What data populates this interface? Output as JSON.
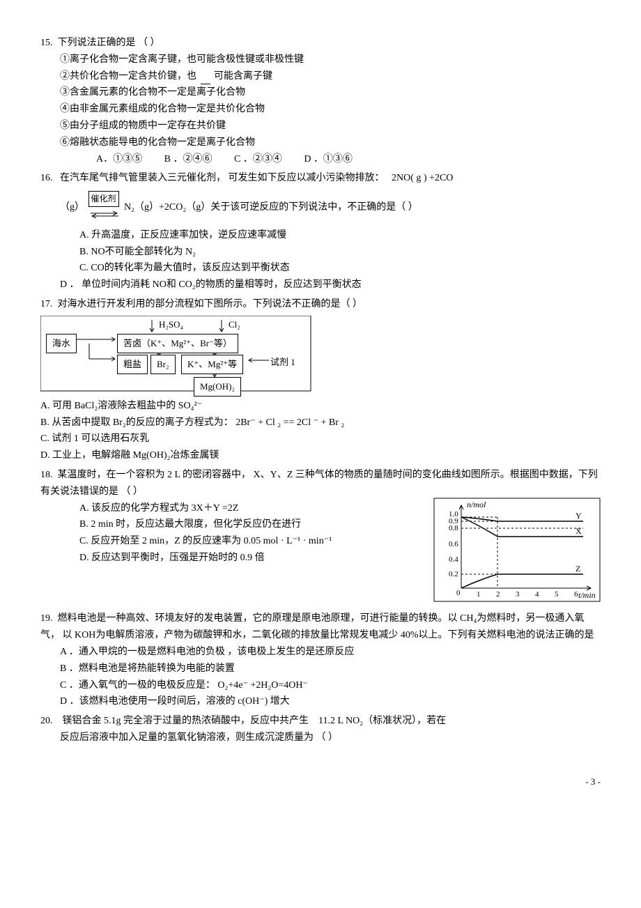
{
  "q15": {
    "stem": "下列说法正确的是        （            ）",
    "s1": "①离子化合物一定含离子键，也可能含极性键或非极性键",
    "s2_a": "②共价化合物一定含共价键，也",
    "s2_b": "可能含离子键",
    "s3": "③含金属元素的化合物不一定是离子化合物",
    "s4": "④由非金属元素组成的化合物一定是共价化合物",
    "s5": "⑤由分子组成的物质中一定存在共价键",
    "s6": "⑥熔融状态能导电的化合物一定是离子化合物",
    "optA": "A．①③⑤",
    "optB": "B ．②④⑥",
    "optC": "C ．②③④",
    "optD": "D ．①③⑥"
  },
  "q16": {
    "stem_a": "在汽车尾气排气管里装入三元催化剂，   可发生如下反应以减小污染物排放：",
    "stem_b": "2NO( g ) +2CO",
    "eq_left": "（g）",
    "eq_cat": "催化剂",
    "eq_right": "N₂（g）+2CO₂（g）关于该可逆反应的下列说法中，不正确的是（            ）",
    "A": "A.   升高温度，正反应速率加快，逆反应速率减慢",
    "B": "B.   NO不可能全部转化为    N₂",
    "C": "C.   CO的转化率为最大值时，该反应达到平衡状态",
    "D": "D ．  单位时间内消耗   NO和 CO₂的物质的量相等时，反应达到平衡状态"
  },
  "q17": {
    "stem": "对海水进行开发利用的部分流程如下图所示。下列说法不正确的是（               ）",
    "diag": {
      "seawater": "海水",
      "h2so4": "H₂SO₄",
      "cl2": "Cl₂",
      "bittern": "苦卤（K⁺、Mg²⁺、Br⁻等）",
      "coarsesalt": "粗盐",
      "br2": "Br₂",
      "kmg": "K⁺、Mg²⁺等",
      "reagent1": "试剂 1",
      "mgoh2": "Mg(OH)₂"
    },
    "A": "A. 可用 BaCl₂溶液除去粗盐中的    SO₄²⁻",
    "B": "B. 从苦卤中提取  Br₂的反应的离子方程式为：   2Br⁻ + Cl ₂ == 2Cl ⁻ + Br ₂",
    "C": "C. 试剂  1 可以选用石灰乳",
    "D": "D. 工业上，电解熔融   Mg(OH)₂冶炼金属镁"
  },
  "q18": {
    "stem": "某温度时，在一个容积为   2 L  的密闭容器中，  X、Y、Z 三种气体的物质的量随时间的变化曲线如图所示。根据图中数据，下列有关说法错误的是        （    ）",
    "A": "A.  该反应的化学方程式为    3X＋Y =2Z",
    "B": "B.  2 min   时，反应达最大限度，但化学反应仍在进行",
    "C": "C.  反应开始至   2  min，Z 的反应速率为  0.05 mol  · L⁻¹ · min⁻¹",
    "D": "D.  反应达到平衡时，压强是开始时的      0.9   倍",
    "chart": {
      "ylabel": "n/mol",
      "xlabel": "t/min",
      "series": {
        "Y": "Y",
        "X": "X",
        "Z": "Z"
      },
      "yticks": [
        "1.0",
        "0.9",
        "0.8",
        "0.6",
        "0.4",
        "0.2",
        "0"
      ],
      "xticks": [
        "1",
        "2",
        "3",
        "4",
        "5",
        "6"
      ]
    }
  },
  "q19": {
    "stem": "燃料电池是一种高效、环境友好的发电装置，它的原理是原电池原理，可进行能量的转换。以     CH₄为燃料时，另一极通入氧气，  以 KOH为电解质溶液，产物为碳酸钾和水，二氧化碳的排放量比常规发电减少       40%以上。下列有关燃料电池的说法正确的是",
    "A": "A ．通入甲烷的一极是燃料电池的负极    ，该电极上发生的是还原反应",
    "B": "B ．燃料电池是将热能转换为电能的装置",
    "C": "C ．通入氧气的一极的电极反应是：     O₂+4e⁻ +2H₂O=4OH⁻",
    "D": "D ．该燃料电池使用一段时间后，溶液的     c(OH⁻) 增大"
  },
  "q20": {
    "stem_a": "镁铝合金  5.1g 完全溶于过量的热浓硝酸中，反应中共产生",
    "stem_b": "11.2  L NO₂（标准状况），若在",
    "line2": "反应后溶液中加入足量的氢氧化钠溶液，则生成沉淀质量为          （      ）"
  },
  "chart_data": {
    "type": "line",
    "xlabel": "t/min",
    "ylabel": "n/mol",
    "xlim": [
      0,
      6.5
    ],
    "ylim": [
      0,
      1.05
    ],
    "xticks": [
      0,
      1,
      2,
      3,
      4,
      5,
      6
    ],
    "yticks": [
      0,
      0.2,
      0.4,
      0.6,
      0.8,
      0.9,
      1.0
    ],
    "series": [
      {
        "name": "Y",
        "x": [
          0,
          2,
          6
        ],
        "y": [
          1.0,
          0.9,
          0.9
        ]
      },
      {
        "name": "X",
        "x": [
          0,
          2,
          6
        ],
        "y": [
          1.0,
          0.7,
          0.7
        ],
        "label_y": 0.8
      },
      {
        "name": "Z",
        "x": [
          0,
          2,
          6
        ],
        "y": [
          0.0,
          0.2,
          0.2
        ]
      }
    ],
    "vline_at_x": 2
  },
  "page_footer": "- 3 -"
}
